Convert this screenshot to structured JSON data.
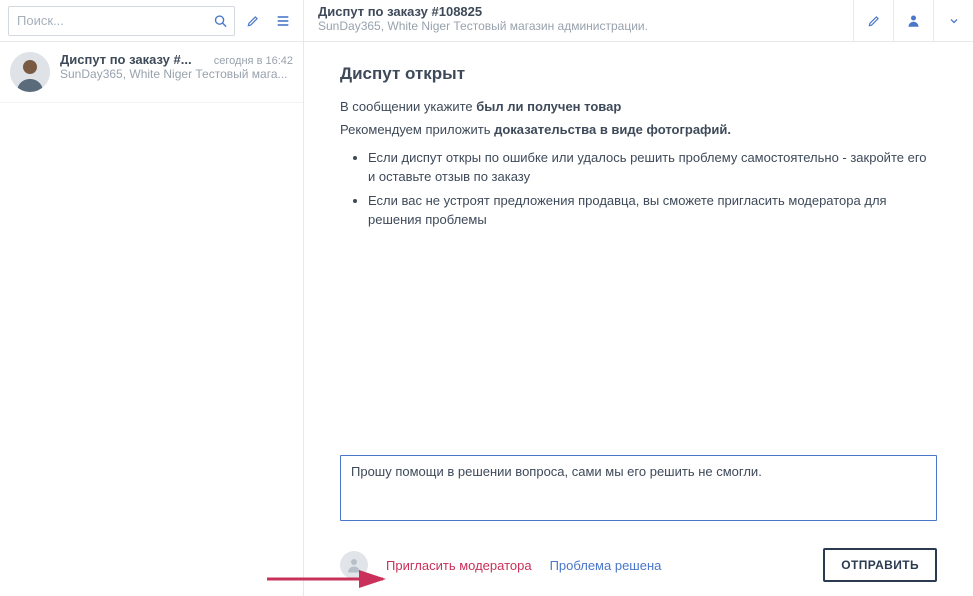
{
  "sidebar": {
    "search_placeholder": "Поиск...",
    "conversations": [
      {
        "title": "Диспут по заказу #...",
        "time": "сегодня в 16:42",
        "subtitle": "SunDay365, White Niger Тестовый мага..."
      }
    ]
  },
  "header": {
    "title": "Диспут по заказу #108825",
    "subtitle": "SunDay365, White Niger Тестовый магазин администрации."
  },
  "content": {
    "section_title": "Диспут открыт",
    "line1_prefix": "В сообщении укажите ",
    "line1_bold": "был ли получен товар",
    "line2_prefix": "Рекомендуем приложить ",
    "line2_bold": "доказательства в виде фотографий.",
    "bullets": [
      "Если диспут откры по ошибке или удалось решить проблему самостоятельно - закройте его и оставьте отзыв по заказу",
      "Если вас не устроят предложения продавца, вы сможете пригласить модератора для решения проблемы"
    ]
  },
  "compose": {
    "value": "Прошу помощи в решении вопроса, сами мы его решить не смогли."
  },
  "footer": {
    "invite_label": "Пригласить модератора",
    "resolved_label": "Проблема решена",
    "send_label": "ОТПРАВИТЬ"
  }
}
